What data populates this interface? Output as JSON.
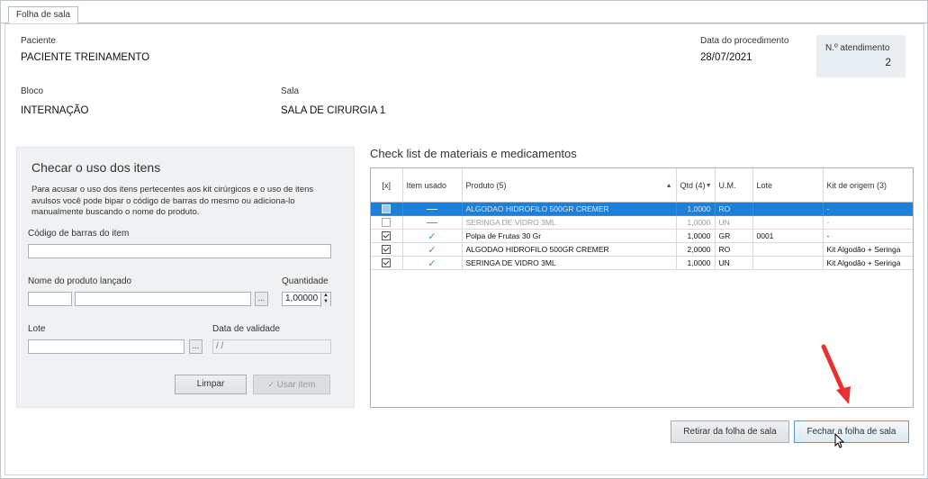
{
  "tab": {
    "label": "Folha de sala"
  },
  "header": {
    "paciente_label": "Paciente",
    "paciente_value": "PACIENTE TREINAMENTO",
    "data_label": "Data do procedimento",
    "data_value": "28/07/2021",
    "atendimento_label": "N.º atendimento",
    "atendimento_value": "2",
    "bloco_label": "Bloco",
    "bloco_value": "INTERNAÇÃO",
    "sala_label": "Sala",
    "sala_value": "SALA DE CIRURGIA 1"
  },
  "left_panel": {
    "title": "Checar o uso dos itens",
    "description": "Para acusar o uso dos itens pertecentes aos kit cirúrgicos e o uso de itens avulsos você pode bipar o código de barras do mesmo ou adiciona-lo manualmente buscando o nome do produto.",
    "barcode_label": "Código de barras do item",
    "barcode_value": "",
    "produto_label": "Nome do produto lançado",
    "quantidade_label": "Quantidade",
    "quantidade_value": "1,00000",
    "lote_label": "Lote",
    "validade_label": "Data de validade",
    "validade_value": "/ /",
    "browse_label": "...",
    "limpar_label": "Limpar",
    "usar_label": "Usar item"
  },
  "checklist": {
    "title": "Check list de materiais e medicamentos",
    "columns": {
      "check": "[x]",
      "usado": "Item usado",
      "produto": "Produto (5)",
      "qtd": "Qtd (4)",
      "um": "U.M.",
      "lote": "Lote",
      "kit": "Kit de origem (3)"
    },
    "rows": [
      {
        "checked": "square",
        "used": "dash",
        "produto": "ALGODAO HIDROFILO 500GR CREMER",
        "qtd": "1,0000",
        "um": "RO",
        "lote": "",
        "kit": "-",
        "state": "selected"
      },
      {
        "checked": "ghost",
        "used": "dash",
        "produto": "SERINGA DE VIDRO 3ML",
        "qtd": "1,0000",
        "um": "UN",
        "lote": "",
        "kit": "-",
        "state": "dim"
      },
      {
        "checked": "on",
        "used": "check",
        "produto": "Polpa de Frutas 30 Gr",
        "qtd": "1,0000",
        "um": "GR",
        "lote": "0001",
        "kit": "-",
        "state": "normal"
      },
      {
        "checked": "on",
        "used": "check",
        "produto": "ALGODAO HIDROFILO 500GR CREMER",
        "qtd": "2,0000",
        "um": "RO",
        "lote": "",
        "kit": "Kit Algodão + Seringa",
        "state": "normal"
      },
      {
        "checked": "on",
        "used": "check",
        "produto": "SERINGA DE VIDRO 3ML",
        "qtd": "1,0000",
        "um": "UN",
        "lote": "",
        "kit": "Kit Algodão + Seringa",
        "state": "normal"
      }
    ]
  },
  "footer": {
    "retirar_label": "Retirar da folha de sala",
    "fechar_label": "Fechar a folha de sala"
  },
  "colors": {
    "selected_row": "#1e7fd9",
    "check_green": "#23a87a",
    "arrow_red": "#e8312f"
  }
}
